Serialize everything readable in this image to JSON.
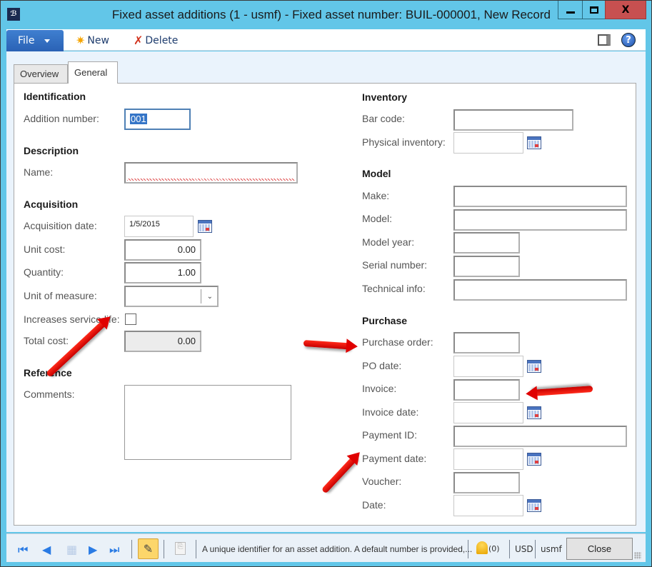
{
  "window": {
    "title": "Fixed asset additions (1 - usmf) - Fixed asset number: BUIL-000001, New Record",
    "app_icon_glyph": "ℬ",
    "minimize_glyph": "",
    "close_glyph": "X"
  },
  "toolbar": {
    "file_label": "File",
    "new_label": "New",
    "new_icon": "✷",
    "delete_label": "Delete",
    "delete_icon": "✗",
    "help_glyph": "?"
  },
  "tabs": [
    {
      "label": "Overview",
      "active": false
    },
    {
      "label": "General",
      "active": true
    }
  ],
  "general": {
    "identification": {
      "heading": "Identification",
      "addition_number_label": "Addition number:",
      "addition_number_value": "001"
    },
    "description": {
      "heading": "Description",
      "name_label": "Name:",
      "name_value": ""
    },
    "acquisition": {
      "heading": "Acquisition",
      "acquisition_date_label": "Acquisition date:",
      "acquisition_date_value": "1/5/2015",
      "unit_cost_label": "Unit cost:",
      "unit_cost_value": "0.00",
      "quantity_label": "Quantity:",
      "quantity_value": "1.00",
      "unit_of_measure_label": "Unit of measure:",
      "unit_of_measure_value": "",
      "increases_service_life_label": "Increases service life:",
      "increases_service_life_checked": false,
      "total_cost_label": "Total cost:",
      "total_cost_value": "0.00"
    },
    "reference": {
      "heading": "Reference",
      "comments_label": "Comments:",
      "comments_value": ""
    },
    "inventory": {
      "heading": "Inventory",
      "bar_code_label": "Bar code:",
      "physical_inventory_label": "Physical inventory:"
    },
    "model": {
      "heading": "Model",
      "make_label": "Make:",
      "model_label": "Model:",
      "model_year_label": "Model year:",
      "serial_number_label": "Serial number:",
      "technical_info_label": "Technical info:"
    },
    "purchase": {
      "heading": "Purchase",
      "purchase_order_label": "Purchase order:",
      "po_date_label": "PO date:",
      "invoice_label": "Invoice:",
      "invoice_date_label": "Invoice date:",
      "payment_id_label": "Payment ID:",
      "payment_date_label": "Payment date:",
      "voucher_label": "Voucher:",
      "date_label": "Date:"
    }
  },
  "statusbar": {
    "first_glyph": "⏮",
    "prev_glyph": "◀",
    "grid_glyph": "▦",
    "next_glyph": "▶",
    "last_glyph": "⏭",
    "edit_glyph": "✎",
    "attach_glyph": "⎘",
    "help_text": "A unique identifier for an asset addition. A default number is provided,...",
    "notifications_count": "(0)",
    "currency": "USD",
    "company": "usmf",
    "close_label": "Close"
  },
  "colors": {
    "window_chrome": "#62c6e8",
    "file_button": "#2a62b5",
    "close_window": "#c75050",
    "annotation_arrow": "#e00000"
  }
}
